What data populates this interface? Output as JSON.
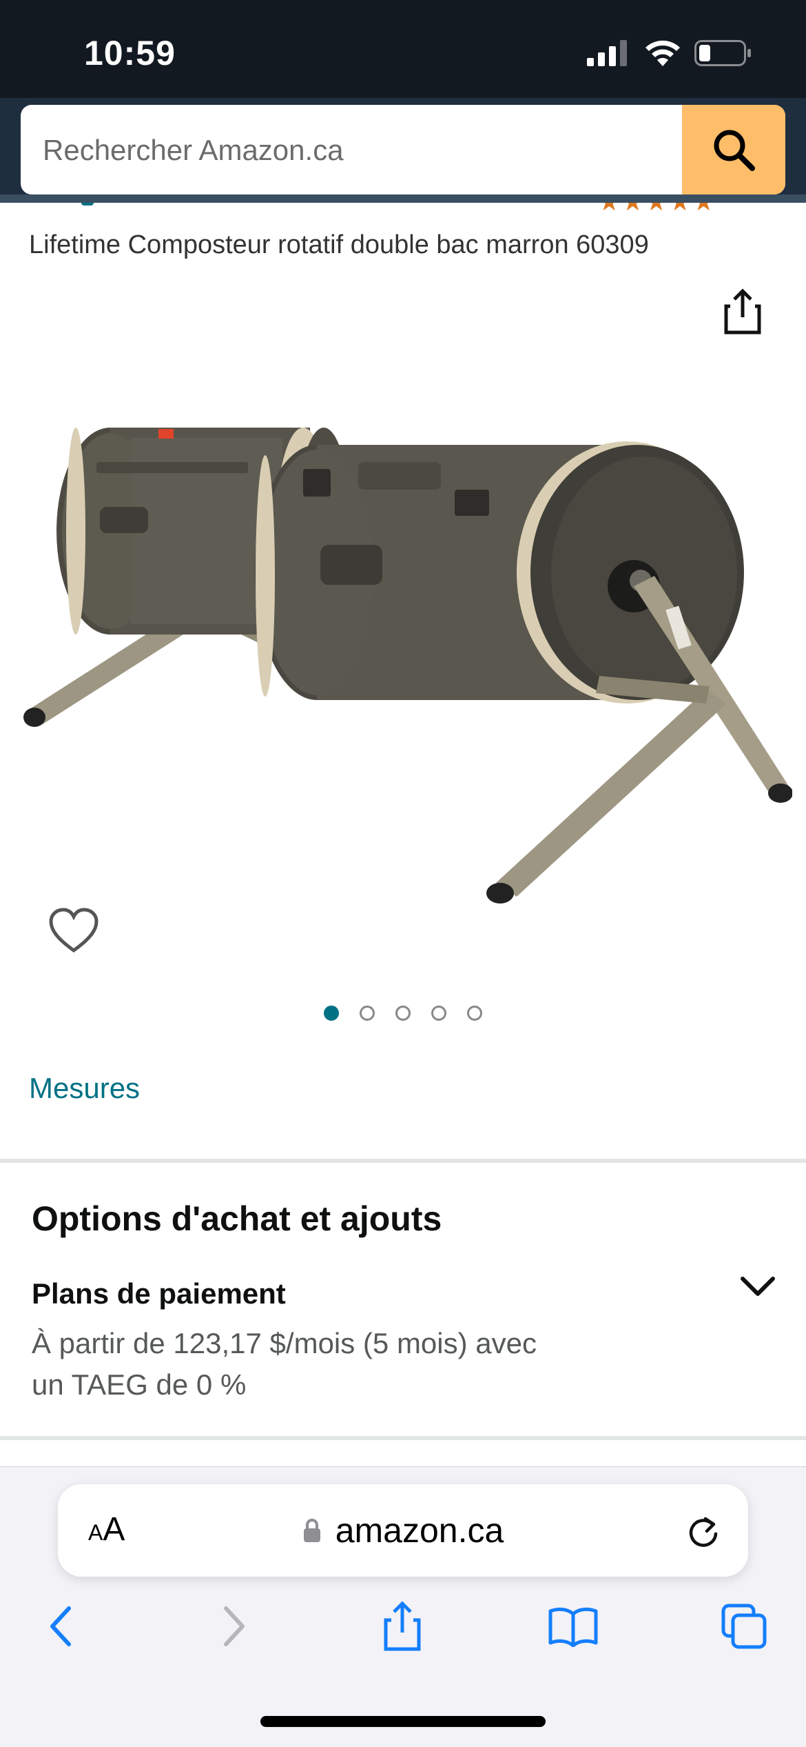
{
  "status_bar": {
    "time": "10:59"
  },
  "search": {
    "placeholder": "Rechercher Amazon.ca"
  },
  "product": {
    "title": "Lifetime Composteur rotatif double bac marron 60309",
    "image_count": 5,
    "active_image_index": 0,
    "measures_label": "Mesures"
  },
  "options": {
    "title": "Options d'achat et ajouts",
    "payment_plans_title": "Plans de paiement",
    "payment_plans_line1": "À partir de 123,17 $/mois (5 mois) avec",
    "payment_plans_line2": "un TAEG de 0 %"
  },
  "browser": {
    "text_size_label_small": "A",
    "text_size_label_large": "A",
    "url": "amazon.ca"
  },
  "colors": {
    "header_bg": "#131921",
    "search_button": "#febd69",
    "link": "#007185",
    "star": "#de7921"
  },
  "icons": {
    "search": "magnifier",
    "share": "share-up-arrow",
    "wishlist": "heart-outline",
    "chevron": "chevron-down",
    "lock": "lock",
    "reload": "reload",
    "back": "chevron-left",
    "forward": "chevron-right",
    "bookmarks": "open-book",
    "tabs": "overlapping-squares"
  }
}
